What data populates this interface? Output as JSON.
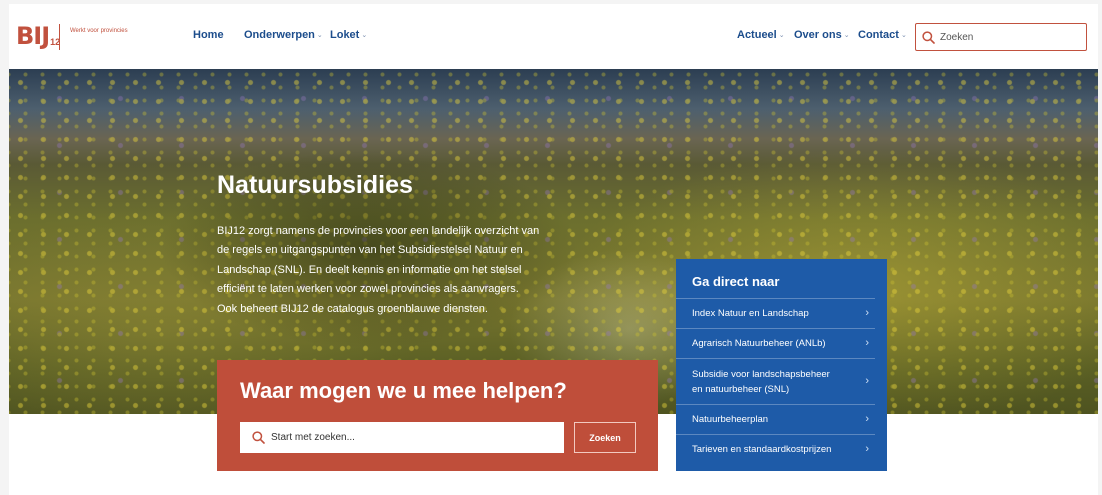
{
  "header": {
    "logo": {
      "mark": "BIJ",
      "sub": "12",
      "tagline": "Werkt voor provincies"
    },
    "nav_left": [
      {
        "label": "Home",
        "has_dropdown": false
      },
      {
        "label": "Onderwerpen",
        "has_dropdown": true
      },
      {
        "label": "Loket",
        "has_dropdown": true
      }
    ],
    "nav_right": [
      {
        "label": "Actueel",
        "has_dropdown": true
      },
      {
        "label": "Over ons",
        "has_dropdown": true
      },
      {
        "label": "Contact",
        "has_dropdown": true
      }
    ],
    "search": {
      "placeholder": "Zoeken",
      "value": ""
    }
  },
  "hero": {
    "title": "Natuursubsidies",
    "lines": [
      "BIJ12 zorgt namens de provincies voor een landelijk overzicht van",
      "de regels en uitgangspunten van het Subsidiestelsel Natuur en",
      "Landschap (SNL). En deelt kennis en informatie om het stelsel",
      "efficiënt te laten werken voor zowel provincies als aanvragers.",
      "Ook beheert BIJ12 de catalogus groenblauwe diensten."
    ]
  },
  "help_box": {
    "title": "Waar mogen we u mee helpen?",
    "search_placeholder": "Start met zoeken...",
    "search_value": "",
    "button_label": "Zoeken"
  },
  "direct": {
    "title": "Ga direct naar",
    "items": [
      {
        "label": "Index Natuur en Landschap"
      },
      {
        "label": "Agrarisch Natuurbeheer (ANLb)"
      },
      {
        "label": "Subsidie voor landschapsbeheer en natuurbeheer (SNL)"
      },
      {
        "label": "Natuurbeheerplan"
      },
      {
        "label": "Tarieven en standaardkostprijzen"
      }
    ]
  },
  "colors": {
    "brand_red": "#bf4e3a",
    "brand_blue": "#1e5ba8",
    "nav_blue": "#1c4d8c"
  },
  "icons": {
    "search": "search-icon",
    "chevron": "chevron-down-icon",
    "arrow": "chevron-right-icon"
  }
}
